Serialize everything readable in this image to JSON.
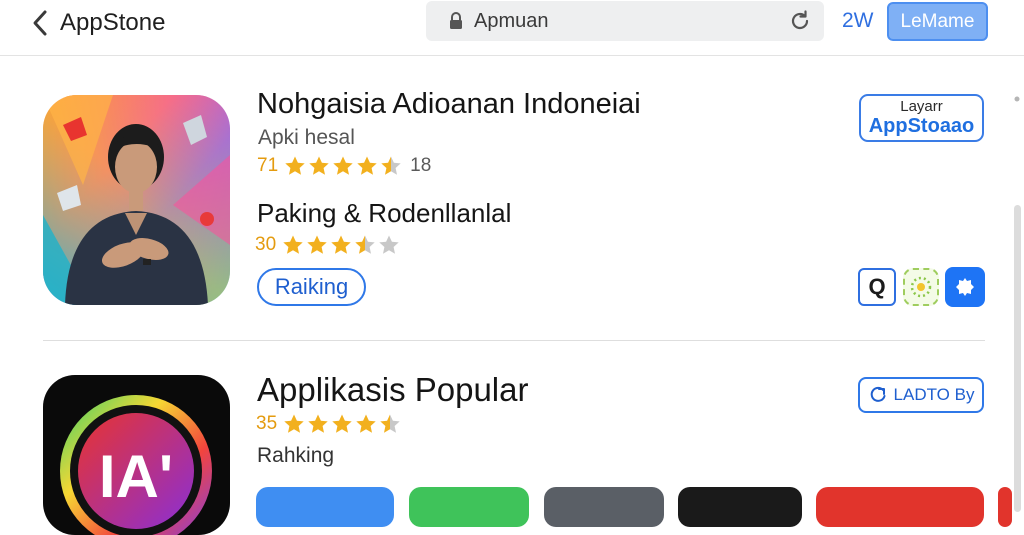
{
  "header": {
    "back_label": "AppStone",
    "address": "Apmuan",
    "tab_count": "2W",
    "login_label": "LeMame"
  },
  "listing_main": {
    "title": "Nohgaisia Adioanan Indoneiai",
    "subtitle": "Apki hesal",
    "rating_value": "71",
    "rating_stars": 4.5,
    "rating_count": "18",
    "badge_small": "Layarr",
    "badge_big": "AppStoaao",
    "category_title": "Paking & Rodenllanlal",
    "category_rating_value": "30",
    "category_rating_stars": 3.5,
    "ranking_button": "Raiking",
    "mini_q_label": "Q"
  },
  "listing_second": {
    "title": "Applikasis Popular",
    "rating_value": "35",
    "rating_stars": 4.5,
    "subtitle": "Rahking",
    "update_button": "LADTO By",
    "icon_text": "IA'"
  },
  "colors": {
    "accent": "#2f78e8",
    "star": "#f2b01e",
    "rating_text": "#e49b0f"
  }
}
